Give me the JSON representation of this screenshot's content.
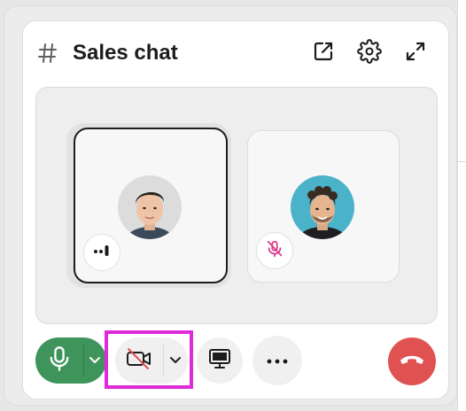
{
  "huddle": {
    "title": "Sales chat",
    "header_icons": [
      "hash-icon",
      "open-in-window-icon",
      "gear-icon",
      "expand-icon"
    ]
  },
  "participants": [
    {
      "avatar": "avatar-man-short-dark-hair",
      "status_badge": "speaking-indicator-icon",
      "active_speaker": true
    },
    {
      "avatar": "avatar-man-curly-hair",
      "status_badge": "mic-muted-icon",
      "active_speaker": false
    }
  ],
  "controls": {
    "mic": {
      "state": "on",
      "icon": "microphone-icon",
      "menu_icon": "chevron-down-icon"
    },
    "camera": {
      "state": "off",
      "icon": "video-off-icon",
      "menu_icon": "chevron-down-icon"
    },
    "screen_share": {
      "icon": "monitor-icon"
    },
    "more": {
      "icon": "more-horizontal-icon"
    },
    "leave": {
      "icon": "hang-up-icon"
    }
  },
  "colors": {
    "mic_green": "#3f945c",
    "end_call_red": "#e05252",
    "muted_pink": "#d63a8a",
    "highlight_magenta": "#e02ad9",
    "active_border": "#1d1c1d"
  }
}
